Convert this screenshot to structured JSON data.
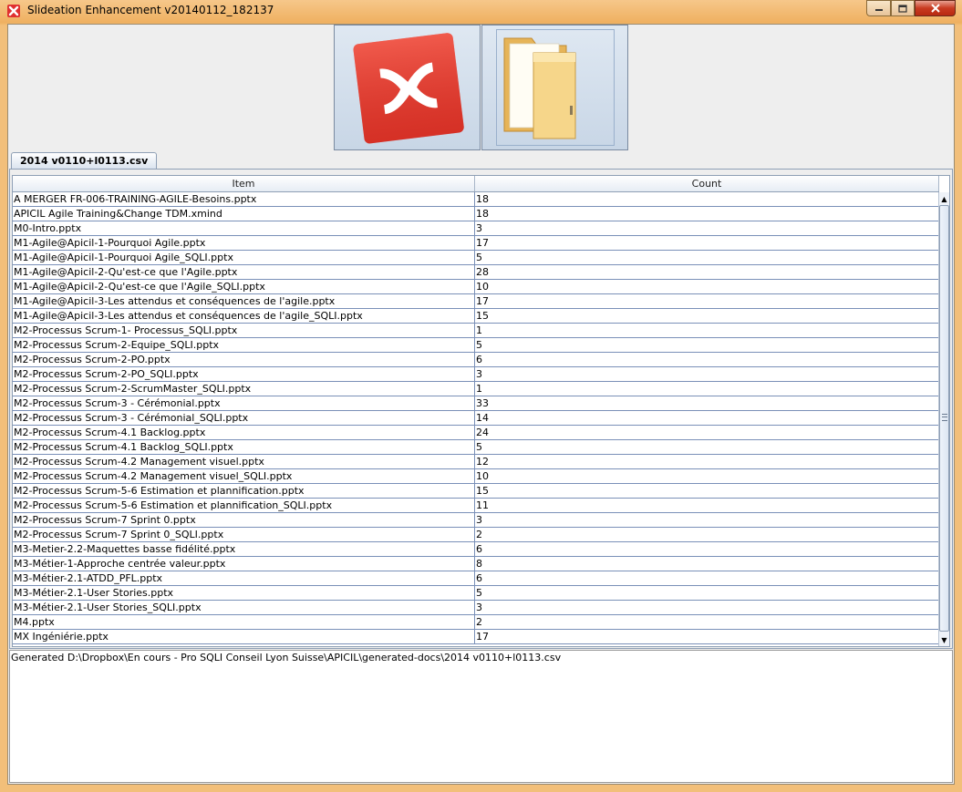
{
  "window": {
    "title": "Slideation Enhancement v20140112_182137",
    "app_icon": "xmind-icon"
  },
  "toolbar": {
    "buttons": [
      {
        "icon": "xmind-logo-icon"
      },
      {
        "icon": "folder-icon"
      }
    ]
  },
  "tabs": [
    {
      "label": "2014 v0110+l0113.csv"
    }
  ],
  "table": {
    "columns": [
      "Item",
      "Count"
    ],
    "rows": [
      {
        "item": "A MERGER FR-006-TRAINING-AGILE-Besoins.pptx",
        "count": "18"
      },
      {
        "item": "APICIL Agile Training&Change TDM.xmind",
        "count": "18"
      },
      {
        "item": "M0-Intro.pptx",
        "count": "3"
      },
      {
        "item": "M1-Agile@Apicil-1-Pourquoi Agile.pptx",
        "count": "17"
      },
      {
        "item": "M1-Agile@Apicil-1-Pourquoi Agile_SQLI.pptx",
        "count": "5"
      },
      {
        "item": "M1-Agile@Apicil-2-Qu'est-ce que l'Agile.pptx",
        "count": "28"
      },
      {
        "item": "M1-Agile@Apicil-2-Qu'est-ce que l'Agile_SQLI.pptx",
        "count": "10"
      },
      {
        "item": "M1-Agile@Apicil-3-Les attendus et conséquences de l'agile.pptx",
        "count": "17"
      },
      {
        "item": "M1-Agile@Apicil-3-Les attendus et conséquences de l'agile_SQLI.pptx",
        "count": "15"
      },
      {
        "item": "M2-Processus Scrum-1- Processus_SQLI.pptx",
        "count": "1"
      },
      {
        "item": "M2-Processus Scrum-2-Equipe_SQLI.pptx",
        "count": "5"
      },
      {
        "item": "M2-Processus Scrum-2-PO.pptx",
        "count": "6"
      },
      {
        "item": "M2-Processus Scrum-2-PO_SQLI.pptx",
        "count": "3"
      },
      {
        "item": "M2-Processus Scrum-2-ScrumMaster_SQLI.pptx",
        "count": "1"
      },
      {
        "item": "M2-Processus Scrum-3 - Cérémonial.pptx",
        "count": "33"
      },
      {
        "item": "M2-Processus Scrum-3 - Cérémonial_SQLI.pptx",
        "count": "14"
      },
      {
        "item": "M2-Processus Scrum-4.1 Backlog.pptx",
        "count": "24"
      },
      {
        "item": "M2-Processus Scrum-4.1 Backlog_SQLI.pptx",
        "count": "5"
      },
      {
        "item": "M2-Processus Scrum-4.2 Management visuel.pptx",
        "count": "12"
      },
      {
        "item": "M2-Processus Scrum-4.2 Management visuel_SQLI.pptx",
        "count": "10"
      },
      {
        "item": "M2-Processus Scrum-5-6 Estimation et plannification.pptx",
        "count": "15"
      },
      {
        "item": "M2-Processus Scrum-5-6 Estimation et plannification_SQLI.pptx",
        "count": "11"
      },
      {
        "item": "M2-Processus Scrum-7 Sprint 0.pptx",
        "count": "3"
      },
      {
        "item": "M2-Processus Scrum-7 Sprint 0_SQLI.pptx",
        "count": "2"
      },
      {
        "item": "M3-Metier-2.2-Maquettes basse fidélité.pptx",
        "count": "6"
      },
      {
        "item": "M3-Métier-1-Approche centrée valeur.pptx",
        "count": "8"
      },
      {
        "item": "M3-Métier-2.1-ATDD_PFL.pptx",
        "count": "6"
      },
      {
        "item": "M3-Métier-2.1-User Stories.pptx",
        "count": "5"
      },
      {
        "item": "M3-Métier-2.1-User Stories_SQLI.pptx",
        "count": "3"
      },
      {
        "item": "M4.pptx",
        "count": "2"
      },
      {
        "item": "MX Ingéniérie.pptx",
        "count": "17"
      }
    ]
  },
  "status": {
    "text": "Generated D:\\Dropbox\\En cours - Pro SQLI Conseil Lyon Suisse\\APICIL\\generated-docs\\2014 v0110+l0113.csv"
  },
  "colors": {
    "title_bar": "#efb060",
    "xmind_red": "#e23a2e",
    "folder_yellow": "#f2cf7a",
    "grid_line": "#7a90b8"
  }
}
